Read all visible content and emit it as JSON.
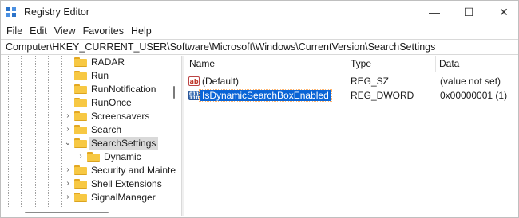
{
  "window": {
    "title": "Registry Editor",
    "controls": {
      "minimize": "—",
      "maximize": "☐",
      "close": "✕"
    }
  },
  "menu": [
    "File",
    "Edit",
    "View",
    "Favorites",
    "Help"
  ],
  "address": "Computer\\HKEY_CURRENT_USER\\Software\\Microsoft\\Windows\\CurrentVersion\\SearchSettings",
  "tree": {
    "items": [
      {
        "label": "RADAR",
        "expander": "",
        "selected": false
      },
      {
        "label": "Run",
        "expander": "",
        "selected": false
      },
      {
        "label": "RunNotification",
        "expander": "",
        "selected": false
      },
      {
        "label": "RunOnce",
        "expander": "",
        "selected": false
      },
      {
        "label": "Screensavers",
        "expander": "›",
        "selected": false
      },
      {
        "label": "Search",
        "expander": "›",
        "selected": false
      },
      {
        "label": "SearchSettings",
        "expander": "⌄",
        "selected": true
      },
      {
        "label": "Dynamic",
        "expander": "›",
        "selected": false
      },
      {
        "label": "Security and Mainte",
        "expander": "›",
        "selected": false
      },
      {
        "label": "Shell Extensions",
        "expander": "›",
        "selected": false
      },
      {
        "label": "SignalManager",
        "expander": "›",
        "selected": false
      }
    ]
  },
  "list": {
    "columns": {
      "name": "Name",
      "type": "Type",
      "data": "Data"
    },
    "rows": [
      {
        "icon": "string-value-icon",
        "icon_text": "ab",
        "name": "(Default)",
        "type": "REG_SZ",
        "data": "(value not set)",
        "selected": false
      },
      {
        "icon": "dword-value-icon",
        "icon_text": "011 110",
        "name": "IsDynamicSearchBoxEnabled",
        "type": "REG_DWORD",
        "data": "0x00000001 (1)",
        "selected": true
      }
    ]
  },
  "colors": {
    "selection": "#0a64d6",
    "folder": "#f7c843",
    "tree_selection": "#d9d9d9"
  }
}
